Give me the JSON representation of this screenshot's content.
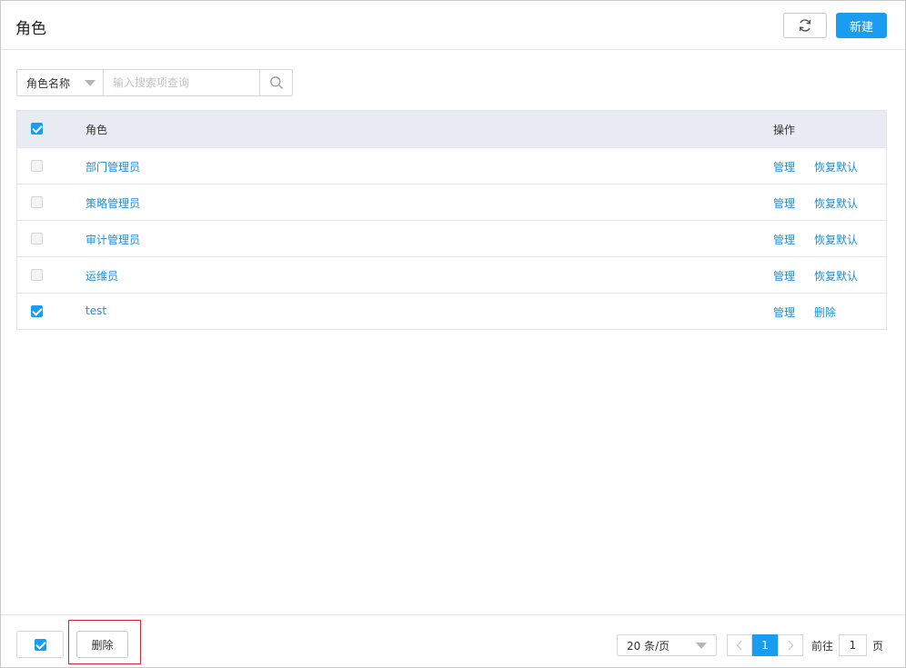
{
  "header": {
    "title": "角色",
    "new_label": "新建"
  },
  "search": {
    "field_label": "角色名称",
    "placeholder": "输入搜索项查询"
  },
  "table": {
    "col_role": "角色",
    "col_ops": "操作",
    "header_checked": true,
    "rows": [
      {
        "name": "部门管理员",
        "op1": "管理",
        "op2": "恢复默认",
        "checked": false
      },
      {
        "name": "策略管理员",
        "op1": "管理",
        "op2": "恢复默认",
        "checked": false
      },
      {
        "name": "审计管理员",
        "op1": "管理",
        "op2": "恢复默认",
        "checked": false
      },
      {
        "name": "运维员",
        "op1": "管理",
        "op2": "恢复默认",
        "checked": false
      },
      {
        "name": "test",
        "op1": "管理",
        "op2": "删除",
        "checked": true
      }
    ]
  },
  "footer": {
    "delete_label": "删除",
    "page_size": "20 条/页",
    "current_page": "1",
    "goto_label": "前往",
    "goto_value": "1",
    "goto_suffix": "页"
  },
  "colors": {
    "accent": "#1a9cf1",
    "link": "#1a8fd8",
    "highlight": "#d9262c"
  },
  "icons": {
    "refresh": "refresh-icon",
    "search": "search-icon",
    "caret": "caret-down-icon"
  }
}
